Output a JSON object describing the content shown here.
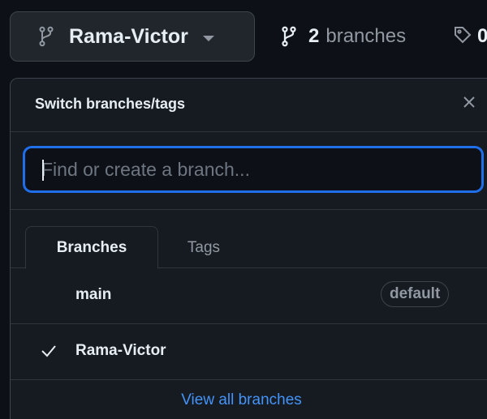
{
  "header": {
    "current_branch": "Rama-Victor",
    "branch_count": "2",
    "branch_count_label": "branches",
    "tag_count": "0"
  },
  "dropdown": {
    "title": "Switch branches/tags",
    "search": {
      "placeholder": "Find or create a branch...",
      "value": ""
    },
    "tabs": [
      {
        "label": "Branches",
        "selected": true
      },
      {
        "label": "Tags",
        "selected": false
      }
    ],
    "branches": [
      {
        "name": "main",
        "badge": "default",
        "checked": false
      },
      {
        "name": "Rama-Victor",
        "badge": "",
        "checked": true
      }
    ],
    "view_all_label": "View all branches"
  },
  "icons": {
    "branch": "git-branch-icon",
    "tag": "tag-icon",
    "close": "close-icon",
    "check": "check-icon",
    "caret": "chevron-down-icon"
  },
  "colors": {
    "background": "#0d1117",
    "panel": "#161b22",
    "border": "#30363d",
    "focus": "#1f6feb",
    "link": "#4493f8",
    "muted": "#9198a1",
    "text": "#e6edf3"
  }
}
